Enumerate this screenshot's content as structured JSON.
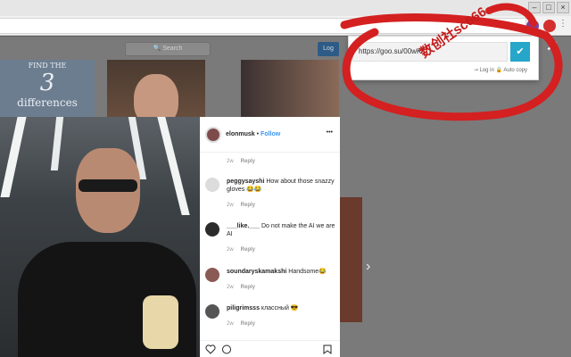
{
  "window": {
    "minimize": "–",
    "maximize": "□",
    "close": "×"
  },
  "page": {
    "search_placeholder": "🔍 Search",
    "login_label": "Log",
    "close_label": "✕",
    "thumb_text_line1": "FIND THE",
    "thumb_text_num": "3",
    "thumb_text_line2": "differences"
  },
  "post": {
    "username": "elonmusk",
    "separator": "•",
    "follow": "Follow",
    "more": "•••",
    "first_meta_time": "2w",
    "first_meta_reply": "Reply",
    "comments": [
      {
        "user": "peggysayshi",
        "text": "How about those snazzy gloves 😂😂",
        "time": "2w",
        "reply": "Reply"
      },
      {
        "user": "___like.___",
        "text": "Do not make the AI we are AI",
        "time": "2w",
        "reply": "Reply"
      },
      {
        "user": "soundaryskamakshi",
        "text": "Handsome😂",
        "time": "2w",
        "reply": "Reply"
      },
      {
        "user": "piligrimsss",
        "text": "классный 😎",
        "time": "2w",
        "reply": "Reply"
      }
    ]
  },
  "popup": {
    "short_url": "https://goo.su/00wK",
    "ok_icon": "✔",
    "login_link": "Log in",
    "autocopy": "Auto copy"
  },
  "watermark": "数创社sc666",
  "colors": {
    "accent": "#26a6c9",
    "follow": "#3897f0",
    "annotation": "#d42020"
  }
}
